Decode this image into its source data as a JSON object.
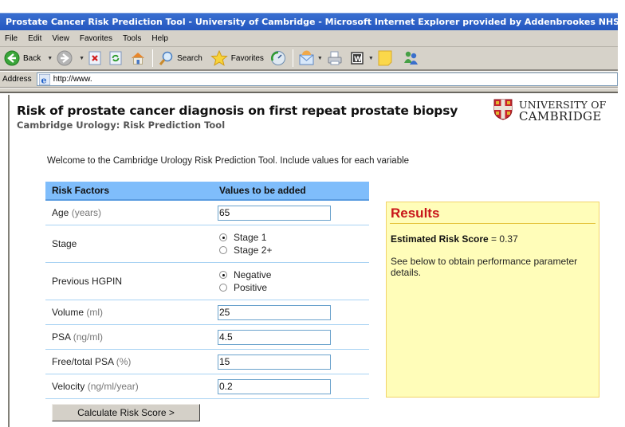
{
  "window": {
    "title": "Prostate Cancer Risk Prediction Tool - University of Cambridge - Microsoft Internet Explorer provided by Addenbrookes NHS Trust"
  },
  "menu": [
    "File",
    "Edit",
    "View",
    "Favorites",
    "Tools",
    "Help"
  ],
  "toolbar": {
    "back_label": "Back",
    "search_label": "Search",
    "favorites_label": "Favorites"
  },
  "address": {
    "label": "Address",
    "url": "http://www."
  },
  "page": {
    "title": "Risk of prostate cancer diagnosis on first repeat prostate biopsy",
    "subtitle": "Cambridge Urology: Risk Prediction Tool",
    "logo_line1": "UNIVERSITY OF",
    "logo_line2": "CAMBRIDGE",
    "welcome": "Welcome to the Cambridge Urology Risk Prediction Tool. Include values for each variable"
  },
  "table": {
    "headers": [
      "Risk Factors",
      "Values to be added"
    ],
    "rows": [
      {
        "label": "Age",
        "unit": "(years)",
        "type": "text",
        "value": "65"
      },
      {
        "label": "Stage",
        "unit": "",
        "type": "radio",
        "options": [
          "Stage 1",
          "Stage 2+"
        ],
        "selected": "Stage 1"
      },
      {
        "label": "Previous HGPIN",
        "unit": "",
        "type": "radio",
        "options": [
          "Negative",
          "Positive"
        ],
        "selected": "Negative"
      },
      {
        "label": "Volume",
        "unit": "(ml)",
        "type": "text",
        "value": "25"
      },
      {
        "label": "PSA",
        "unit": "(ng/ml)",
        "type": "text",
        "value": "4.5"
      },
      {
        "label": "Free/total PSA",
        "unit": "(%)",
        "type": "text",
        "value": "15"
      },
      {
        "label": "Velocity",
        "unit": "(ng/ml/year)",
        "type": "text",
        "value": "0.2"
      }
    ],
    "calculate_label": "Calculate Risk Score >"
  },
  "results": {
    "title": "Results",
    "score_label": "Estimated Risk Score",
    "score_sep": " = ",
    "score_value": "0.37",
    "note": "See below to obtain performance parameter details."
  },
  "colors": {
    "header_blue": "#7fbdfb",
    "results_bg": "#fffdb9",
    "results_title": "#c8151a",
    "titlebar": "#2457c0"
  }
}
